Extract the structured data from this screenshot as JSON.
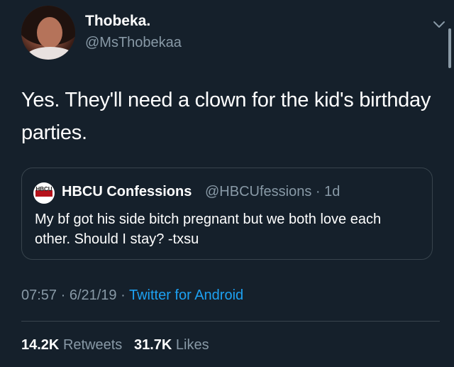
{
  "author": {
    "name": "Thobeka.",
    "handle": "@MsThobekaa"
  },
  "tweet": {
    "text": "Yes. They'll need a clown for the kid's birthday parties."
  },
  "quoted_tweet": {
    "logo_text": "HBCU",
    "name": "HBCU Confessions",
    "meta": "@HBCUfessions · 1d",
    "text": "My bf got his side bitch pregnant but we both love each other. Should I stay? -txsu"
  },
  "meta": {
    "time_date": "07:57 · 6/21/19 · ",
    "source": "Twitter for Android"
  },
  "stats": {
    "retweets_count": "14.2K",
    "retweets_label": "Retweets",
    "likes_count": "31.7K",
    "likes_label": "Likes"
  },
  "colors": {
    "background": "#15202b",
    "secondary_text": "#8899a6",
    "link": "#1da1f2",
    "border": "#38444d"
  },
  "icons": {
    "more": "chevron-down-icon"
  }
}
